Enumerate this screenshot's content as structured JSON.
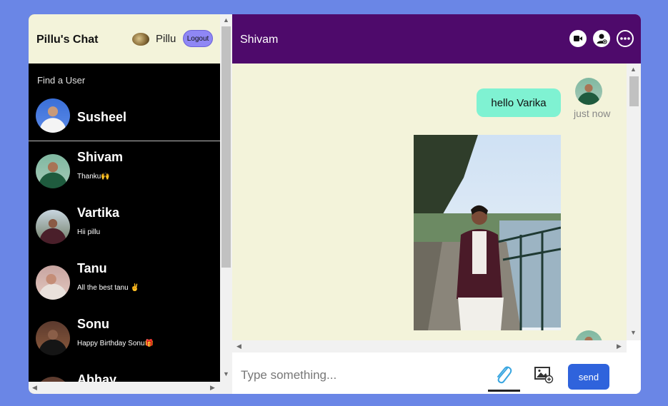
{
  "sidebar": {
    "brand": "Pillu's Chat",
    "current_user": "Pillu",
    "logout_label": "Logout",
    "find_placeholder": "Find a User",
    "search_result": {
      "name": "Susheel"
    },
    "chats": [
      {
        "name": "Shivam",
        "last_message": "Thanku🙌"
      },
      {
        "name": "Vartika",
        "last_message": "Hii pillu"
      },
      {
        "name": "Tanu",
        "last_message": "All the best tanu ✌️"
      },
      {
        "name": "Sonu",
        "last_message": "Happy Birthday Sonu🎁"
      },
      {
        "name": "Abhay",
        "last_message": ""
      }
    ]
  },
  "chat": {
    "title": "Shivam",
    "header_icons": [
      "video-icon",
      "add-user-icon",
      "more-icon"
    ],
    "messages": [
      {
        "text": "hello Varika",
        "time": "just now"
      }
    ],
    "input_placeholder": "Type something...",
    "send_label": "send"
  },
  "colors": {
    "background": "#6a86e6",
    "header_purple": "#4e0a6b",
    "cream": "#f3f3da",
    "bubble": "#7ff2d2",
    "send": "#2f63dc",
    "logout": "#8f87f5"
  }
}
